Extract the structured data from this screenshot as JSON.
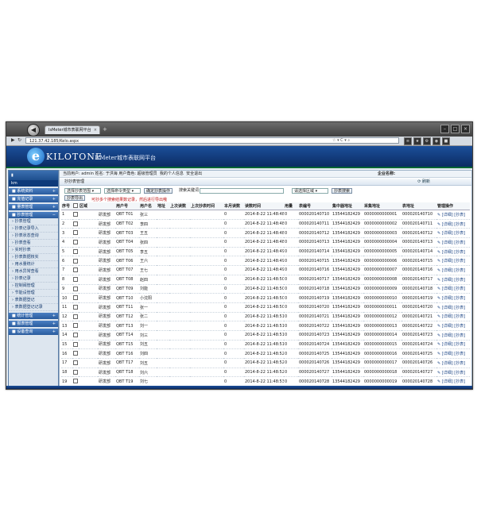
{
  "browser": {
    "tab_title": "IsMeter城市表联网平台",
    "address": "121.37.42.185/Kelo.aspx",
    "new_tab": "+"
  },
  "header": {
    "brand": "KILOTONE",
    "platform": "IsMeter城市表联网平台"
  },
  "userbar": {
    "text": "当前用户: admin  姓名: 于洪海  用户角色: 超级管理员",
    "my_info": "我的个人信息",
    "logout": "安全退出",
    "enterprise": "企业名称:"
  },
  "sidebar": {
    "top_icon": "▮",
    "user": "km",
    "groups": [
      {
        "label": "系统资料",
        "pm": "+"
      },
      {
        "label": "充值记录",
        "pm": "+"
      },
      {
        "label": "量表管理",
        "pm": "+"
      },
      {
        "label": "抄表管理",
        "pm": "−"
      }
    ],
    "sub_items": [
      "抄表管理",
      "抄表记录导入",
      "抄表状态查询",
      "抄表查看",
      "实时抄表",
      "抄表数据核实",
      "用水量统计",
      "用水异常查看",
      "抄表记录",
      "控制阀管理",
      "节能设管理",
      "表数据登记",
      "表数据登记记录"
    ],
    "bottom_groups": [
      {
        "label": "统计管理",
        "pm": "+"
      },
      {
        "label": "报表管理",
        "pm": "+"
      },
      {
        "label": "设备查询",
        "pm": "+"
      }
    ]
  },
  "panel": {
    "title": "抄抄表管理",
    "refresh": "刷新"
  },
  "filters": {
    "area_select": "选择抄表范围",
    "type_select": "选择命令类型",
    "confirm_btn": "确定抄表操作",
    "search_label": "搜索关键词",
    "region_select": "请选择区域",
    "search_btn": "抄表搜索"
  },
  "actions": {
    "batch_btn": "抄表导出",
    "hint": "可抄多个搜索结果数记录，然后进行导出哦"
  },
  "table": {
    "headers": [
      "序号",
      "",
      "区域",
      "",
      "用户号",
      "用户名",
      "地址",
      "上次读数",
      "上次抄表时间",
      "本月读数",
      "读数时间",
      "用量",
      "表编号",
      "集中器地址",
      "采集地址",
      "表地址",
      "管理操作"
    ],
    "rows": [
      [
        "1",
        "研发部",
        "QBT T01",
        "张三",
        "",
        "",
        "",
        "0",
        "2014-8-22 11:48:48",
        "0",
        "000020140710",
        "13544182429",
        "0000000000001",
        "000020140710"
      ],
      [
        "2",
        "研发部",
        "QBT T02",
        "李四",
        "",
        "",
        "",
        "0",
        "2014-8-22 11:48:48",
        "0",
        "000020140711",
        "13544182429",
        "0000000000002",
        "000020140711"
      ],
      [
        "3",
        "研发部",
        "QBT T03",
        "王五",
        "",
        "",
        "",
        "0",
        "2014-8-22 11:48:48",
        "0",
        "000020140712",
        "13544182429",
        "0000000000003",
        "000020140712"
      ],
      [
        "4",
        "研发部",
        "QBT T04",
        "张四",
        "",
        "",
        "",
        "0",
        "2014-8-22 11:48:48",
        "0",
        "000020140713",
        "13544182429",
        "0000000000004",
        "000020140713"
      ],
      [
        "5",
        "研发部",
        "QBT T05",
        "李五",
        "",
        "",
        "",
        "0",
        "2014-8-22 11:48:49",
        "0",
        "000020140714",
        "13544182429",
        "0000000000005",
        "000020140714"
      ],
      [
        "6",
        "研发部",
        "QBT T06",
        "王六",
        "",
        "",
        "",
        "0",
        "2014-8-22 11:48:49",
        "0",
        "000020140715",
        "13544182429",
        "0000000000006",
        "000020140715"
      ],
      [
        "7",
        "研发部",
        "QBT T07",
        "王七",
        "",
        "",
        "",
        "0",
        "2014-8-22 11:48:49",
        "0",
        "000020140716",
        "13544182429",
        "0000000000007",
        "000020140716"
      ],
      [
        "8",
        "研发部",
        "QBT T08",
        "赵四",
        "",
        "",
        "",
        "0",
        "2014-8-22 11:48:50",
        "0",
        "000020140717",
        "13544182429",
        "0000000000008",
        "000020140717"
      ],
      [
        "9",
        "研发部",
        "QBT T09",
        "刘能",
        "",
        "",
        "",
        "0",
        "2014-8-22 11:48:50",
        "0",
        "000020140718",
        "13544182429",
        "0000000000009",
        "000020140718"
      ],
      [
        "10",
        "研发部",
        "QBT T10",
        "小沈阳",
        "",
        "",
        "",
        "0",
        "2014-8-22 11:48:50",
        "0",
        "000020140719",
        "13544182429",
        "0000000000010",
        "000020140719"
      ],
      [
        "11",
        "研发部",
        "QBT T11",
        "张一",
        "",
        "",
        "",
        "0",
        "2014-8-22 11:48:50",
        "0",
        "000020140720",
        "13544182429",
        "0000000000011",
        "000020140720"
      ],
      [
        "12",
        "研发部",
        "QBT T12",
        "张二",
        "",
        "",
        "",
        "0",
        "2014-8-22 11:48:51",
        "0",
        "000020140721",
        "13544182429",
        "0000000000012",
        "000020140721"
      ],
      [
        "13",
        "研发部",
        "QBT T13",
        "刘一",
        "",
        "",
        "",
        "0",
        "2014-8-22 11:48:51",
        "0",
        "000020140722",
        "13544182429",
        "0000000000013",
        "000020140722"
      ],
      [
        "14",
        "研发部",
        "QBT T14",
        "刘三",
        "",
        "",
        "",
        "0",
        "2014-8-22 11:48:51",
        "0",
        "000020140723",
        "13544182429",
        "0000000000014",
        "000020140723"
      ],
      [
        "15",
        "研发部",
        "QBT T15",
        "刘五",
        "",
        "",
        "",
        "0",
        "2014-8-22 11:48:51",
        "0",
        "000020140724",
        "13544182429",
        "0000000000015",
        "000020140724"
      ],
      [
        "16",
        "研发部",
        "QBT T16",
        "刘四",
        "",
        "",
        "",
        "0",
        "2014-8-22 11:48:52",
        "0",
        "000020140725",
        "13544182429",
        "0000000000016",
        "000020140725"
      ],
      [
        "17",
        "研发部",
        "QBT T17",
        "刘五",
        "",
        "",
        "",
        "0",
        "2014-8-22 11:48:52",
        "0",
        "000020140726",
        "13544182429",
        "0000000000017",
        "000020140726"
      ],
      [
        "18",
        "研发部",
        "QBT T18",
        "刘六",
        "",
        "",
        "",
        "0",
        "2014-8-22 11:48:52",
        "0",
        "000020140727",
        "13544182429",
        "0000000000018",
        "000020140727"
      ],
      [
        "19",
        "研发部",
        "QBT T19",
        "刘七",
        "",
        "",
        "",
        "0",
        "2014-8-22 11:48:53",
        "0",
        "000020140728",
        "13544182429",
        "0000000000019",
        "000020140728"
      ],
      [
        "20",
        "研发部",
        "QBT T20",
        "刘八",
        "",
        "",
        "",
        "0",
        "2014-8-22 11:48:53",
        "0",
        "000020140729",
        "13544182429",
        "0000000000020",
        "000020140729"
      ]
    ],
    "op_label": "[详细] [抄表]"
  }
}
